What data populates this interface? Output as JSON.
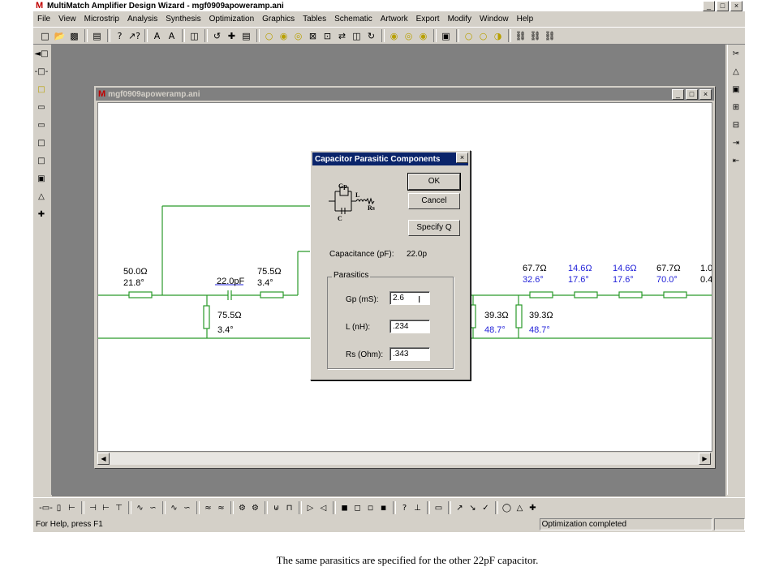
{
  "app": {
    "title": "MultiMatch Amplifier Design Wizard - mgf0909apoweramp.ani",
    "logo": "M",
    "window_buttons": [
      "_",
      "□",
      "×"
    ]
  },
  "menu": [
    "File",
    "View",
    "Microstrip",
    "Analysis",
    "Synthesis",
    "Optimization",
    "Graphics",
    "Tables",
    "Schematic",
    "Artwork",
    "Export",
    "Modify",
    "Window",
    "Help"
  ],
  "toolbar_icons": [
    "new-icon",
    "open-icon",
    "save-icon",
    "print-icon",
    "help-icon",
    "context-help-icon",
    "wizard-a-icon",
    "wizard-b-icon",
    "toolbar-icon-1",
    "toolbar-icon-2",
    "toolbar-icon-3",
    "toolbar-icon-4",
    "toolbar-icon-5",
    "circle-icon",
    "circle-icon",
    "circle-icon",
    "box-icon",
    "toolbar-icon-6",
    "toolbar-icon-7",
    "toolbar-icon-8",
    "toolbar-icon-9",
    "toolbar-icon-10",
    "toolbar-icon-11",
    "toolbar-icon-12",
    "toolbar-icon-13",
    "toolbar-icon-14",
    "toolbar-icon-15",
    "toolbar-icon-16",
    "toolbar-icon-17"
  ],
  "child": {
    "title": "mgf0909apoweramp.ani",
    "buttons": [
      "_",
      "□",
      "×"
    ]
  },
  "schematic": {
    "labels": [
      {
        "text": "50.0Ω",
        "blue": false
      },
      {
        "text": "21.8°",
        "blue": false
      },
      {
        "text": "22.0pF",
        "blue": false
      },
      {
        "text": "75.5Ω",
        "blue": false
      },
      {
        "text": "3.4°",
        "blue": false
      },
      {
        "text": "75.5Ω",
        "blue": false
      },
      {
        "text": "3.4°",
        "blue": false
      },
      {
        "text": "39.3Ω",
        "blue": false
      },
      {
        "text": "48.7°",
        "blue": true
      },
      {
        "text": "39.3Ω",
        "blue": false
      },
      {
        "text": "48.7°",
        "blue": true
      },
      {
        "text": "67.7Ω",
        "blue": false
      },
      {
        "text": "32.6°",
        "blue": true
      },
      {
        "text": "14.6Ω",
        "blue": true
      },
      {
        "text": "17.6°",
        "blue": true
      },
      {
        "text": "14.6Ω",
        "blue": true
      },
      {
        "text": "17.6°",
        "blue": true
      },
      {
        "text": "67.7Ω",
        "blue": false
      },
      {
        "text": "70.0°",
        "blue": true
      },
      {
        "text": "1.0",
        "blue": false
      },
      {
        "text": "0.4",
        "blue": false
      }
    ]
  },
  "dialog": {
    "title": "Capacitor Parasitic Components",
    "close": "×",
    "ok": "OK",
    "cancel": "Cancel",
    "specify_q": "Specify Q",
    "capacitance_label": "Capacitance (pF):",
    "capacitance_value": "22.0p",
    "group_title": "Parasitics",
    "gp_label": "Gp (mS):",
    "gp_value": "2.6",
    "l_label": "L (nH):",
    "l_value": ".234",
    "rs_label": "Rs (Ohm):",
    "rs_value": ".343",
    "diagram_labels": {
      "gp": "Gp",
      "l": "L",
      "c": "C",
      "rs": "Rs"
    }
  },
  "status": {
    "help": "For Help, press F1",
    "message": "Optimization completed"
  },
  "caption": "The same parasitics are specified for the other 22pF capacitor."
}
